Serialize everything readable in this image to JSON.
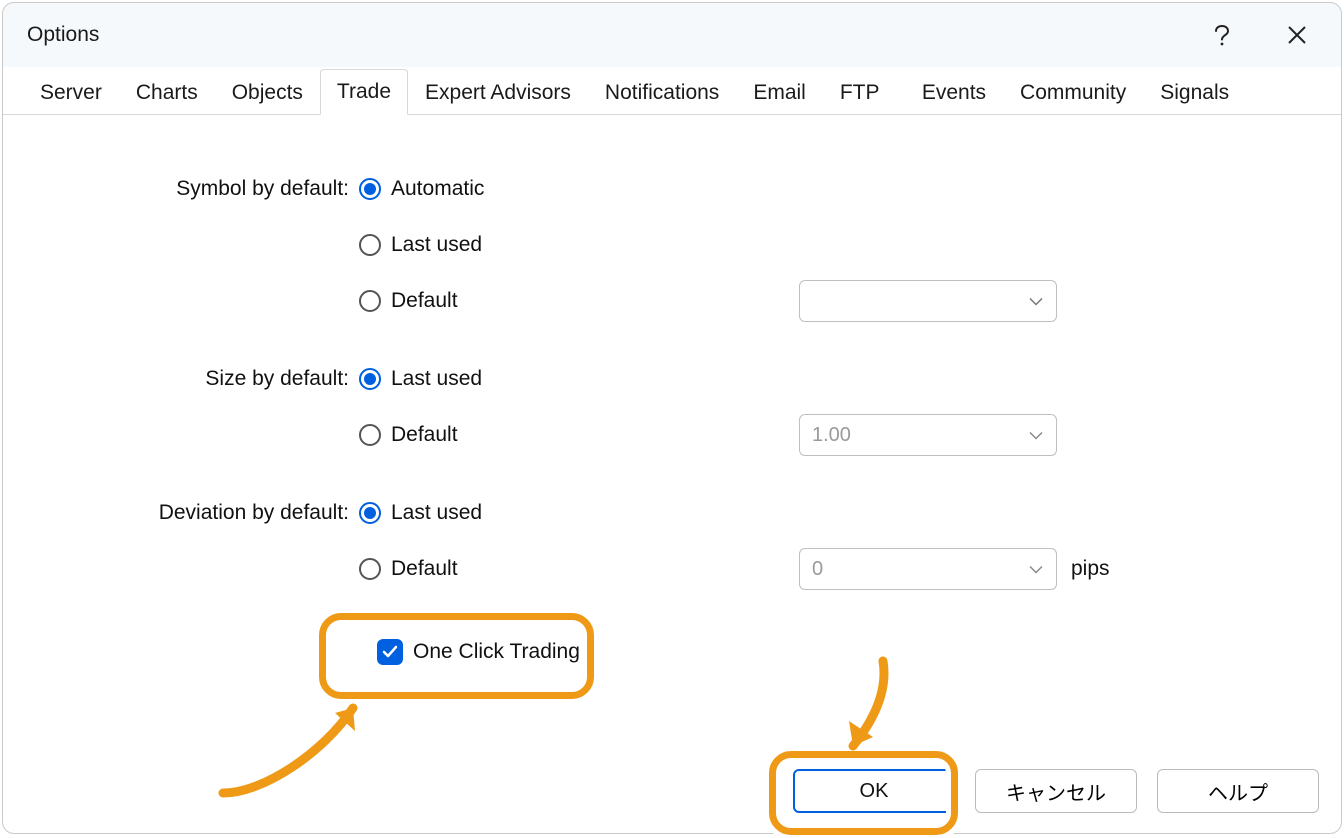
{
  "window": {
    "title": "Options"
  },
  "tabs": {
    "items": [
      "Server",
      "Charts",
      "Objects",
      "Trade",
      "Expert Advisors",
      "Notifications",
      "Email",
      "FTP",
      "Events",
      "Community",
      "Signals"
    ],
    "active": "Trade"
  },
  "form": {
    "symbol": {
      "label": "Symbol by default:",
      "options": {
        "automatic": "Automatic",
        "last_used": "Last used",
        "default": "Default"
      },
      "selected": "automatic",
      "default_combo": ""
    },
    "size": {
      "label": "Size by default:",
      "options": {
        "last_used": "Last used",
        "default": "Default"
      },
      "selected": "last_used",
      "default_combo": "1.00"
    },
    "deviation": {
      "label": "Deviation by default:",
      "options": {
        "last_used": "Last used",
        "default": "Default"
      },
      "selected": "last_used",
      "default_combo": "0",
      "suffix": "pips"
    },
    "one_click": {
      "label": "One Click Trading",
      "checked": true
    }
  },
  "buttons": {
    "ok": "OK",
    "cancel": "キャンセル",
    "help": "ヘルプ"
  }
}
